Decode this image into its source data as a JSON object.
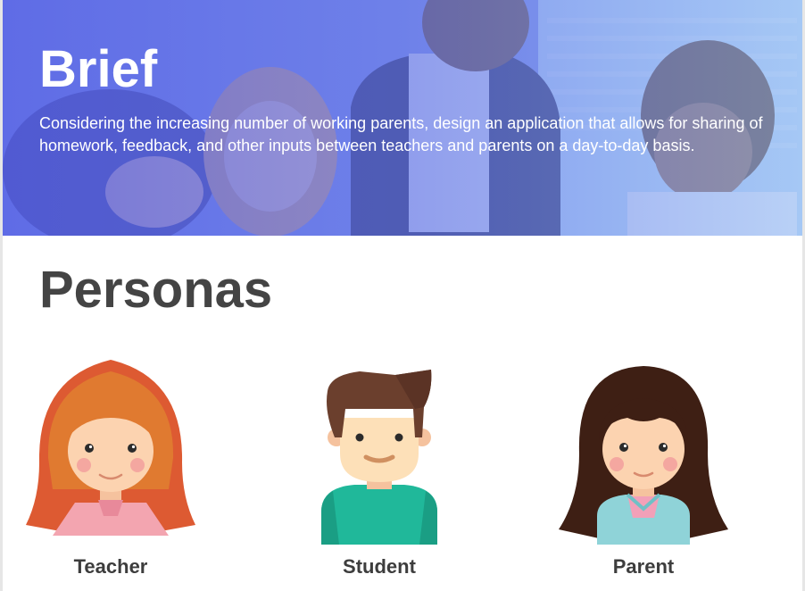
{
  "brief": {
    "title": "Brief",
    "description": "Considering the increasing number of working parents, design an application that allows for sharing of homework, feedback, and other inputs between teachers and parents on a day-to-day basis."
  },
  "personas": {
    "title": "Personas",
    "items": [
      {
        "label": "Teacher",
        "icon": "teacher-avatar-icon"
      },
      {
        "label": "Student",
        "icon": "student-avatar-icon"
      },
      {
        "label": "Parent",
        "icon": "parent-avatar-icon"
      }
    ]
  },
  "colors": {
    "hero_gradient_start": "#5a67e6",
    "hero_gradient_end": "#a9cdf6",
    "heading_text": "#444444",
    "label_text": "#3d3d3d"
  }
}
